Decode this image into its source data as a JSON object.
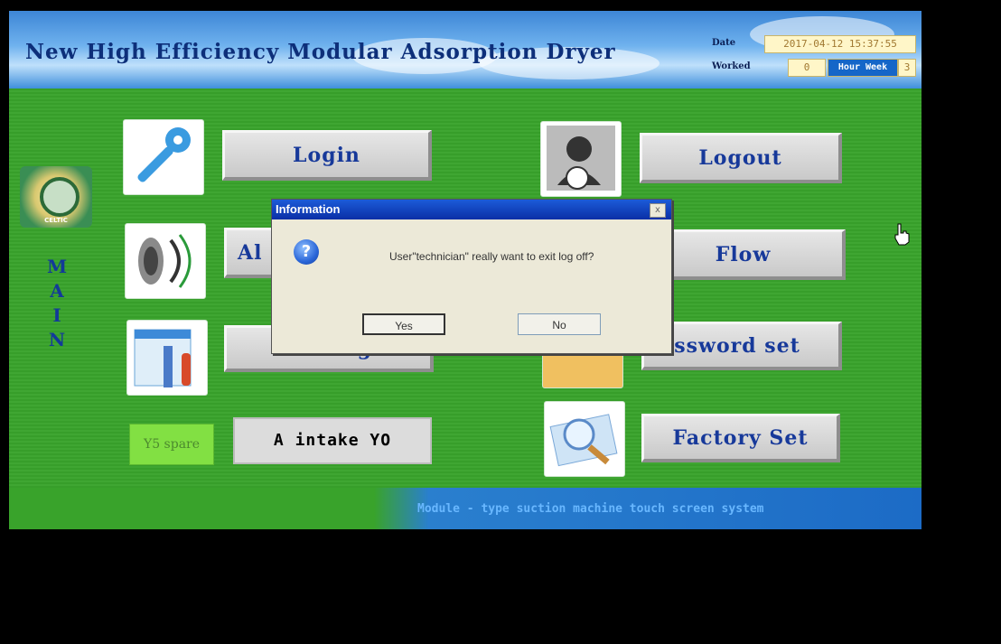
{
  "header": {
    "title": "New High Efficiency Modular Adsorption Dryer",
    "date_label": "Date",
    "date_value": "2017-04-12 15:37:55",
    "worked_label": "Worked",
    "worked_value": "0",
    "hour_week_label": "Hour Week",
    "hour_week_value": "3"
  },
  "sidebar": {
    "logo_text": "CELTIC",
    "vertical_label": "MAIN"
  },
  "buttons": {
    "login": "Login",
    "logout": "Logout",
    "alarm": "Al",
    "flow": "Flow",
    "setting": "Setting",
    "password_set": "assword set",
    "factory_set": "Factory Set",
    "a_intake": "A intake YO",
    "spare": "Y5 spare"
  },
  "footer": {
    "text": "Module - type suction machine touch screen system"
  },
  "dialog": {
    "title": "Information",
    "message": "User\"technician\" really want to exit log off?",
    "yes_label": "Yes",
    "no_label": "No",
    "close_label": "x"
  },
  "colors": {
    "background_green": "#39a32b",
    "button_text_blue": "#17399a",
    "dialog_titlebar": "#0a2fa6"
  }
}
